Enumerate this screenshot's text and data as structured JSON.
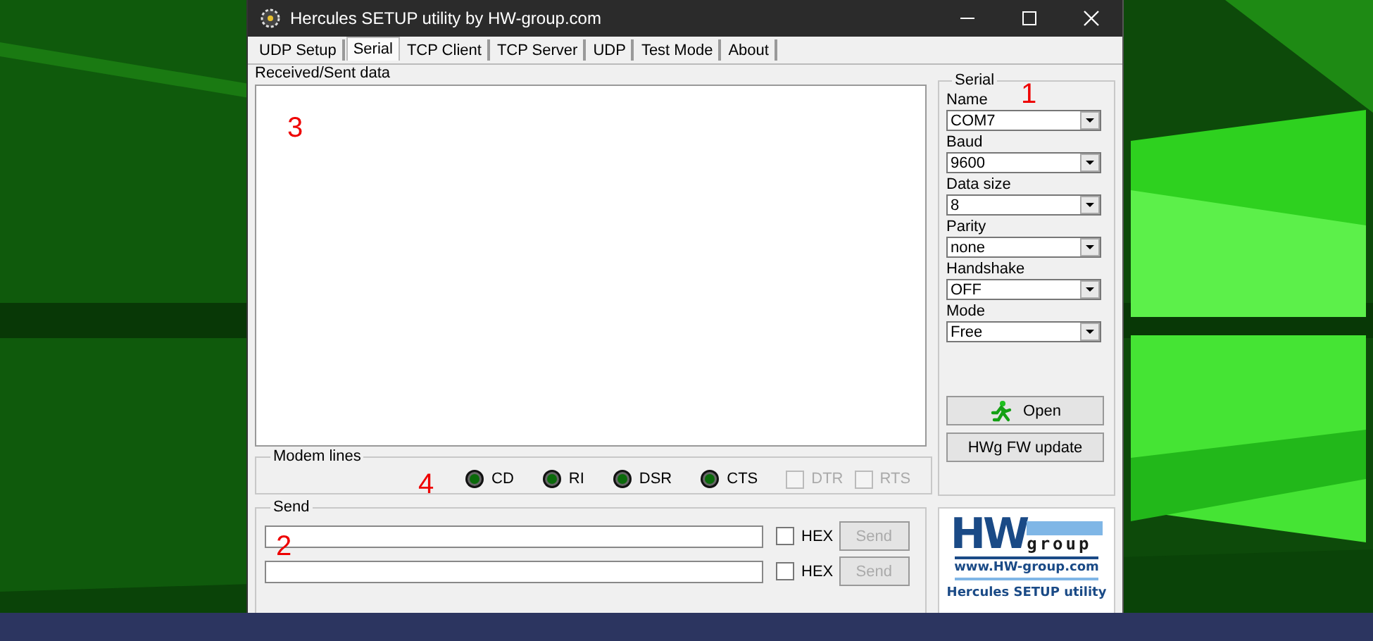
{
  "window": {
    "title": "Hercules SETUP utility by HW-group.com"
  },
  "tabs": [
    {
      "label": "UDP Setup",
      "selected": false
    },
    {
      "label": "Serial",
      "selected": true
    },
    {
      "label": "TCP Client",
      "selected": false
    },
    {
      "label": "TCP Server",
      "selected": false
    },
    {
      "label": "UDP",
      "selected": false
    },
    {
      "label": "Test Mode",
      "selected": false
    },
    {
      "label": "About",
      "selected": false
    }
  ],
  "received": {
    "label": "Received/Sent data",
    "annotation": "3"
  },
  "serial": {
    "title": "Serial",
    "annotation": "1",
    "fields": [
      {
        "label": "Name",
        "value": "COM7"
      },
      {
        "label": "Baud",
        "value": "9600"
      },
      {
        "label": "Data size",
        "value": "8"
      },
      {
        "label": "Parity",
        "value": "none"
      },
      {
        "label": "Handshake",
        "value": "OFF"
      },
      {
        "label": "Mode",
        "value": "Free"
      }
    ],
    "buttons": [
      {
        "label": "Open",
        "kind": "open"
      },
      {
        "label": "HWg FW update",
        "kind": "plain"
      }
    ]
  },
  "modem_lines": {
    "title": "Modem lines",
    "annotation": "4",
    "leds": [
      {
        "label": "CD"
      },
      {
        "label": "RI"
      },
      {
        "label": "DSR"
      },
      {
        "label": "CTS"
      }
    ],
    "outputs": [
      {
        "label": "DTR",
        "checked": false,
        "disabled": true
      },
      {
        "label": "RTS",
        "checked": false,
        "disabled": true
      }
    ]
  },
  "send": {
    "title": "Send",
    "annotation": "2",
    "rows": [
      {
        "hex_label": "HEX",
        "hex_checked": false,
        "button": "Send",
        "disabled": true
      },
      {
        "hex_label": "HEX",
        "hex_checked": false,
        "button": "Send",
        "disabled": true
      }
    ]
  },
  "logo": {
    "mark": "HW",
    "word": "group",
    "url": "www.HW-group.com",
    "product": "Hercules SETUP utility"
  }
}
